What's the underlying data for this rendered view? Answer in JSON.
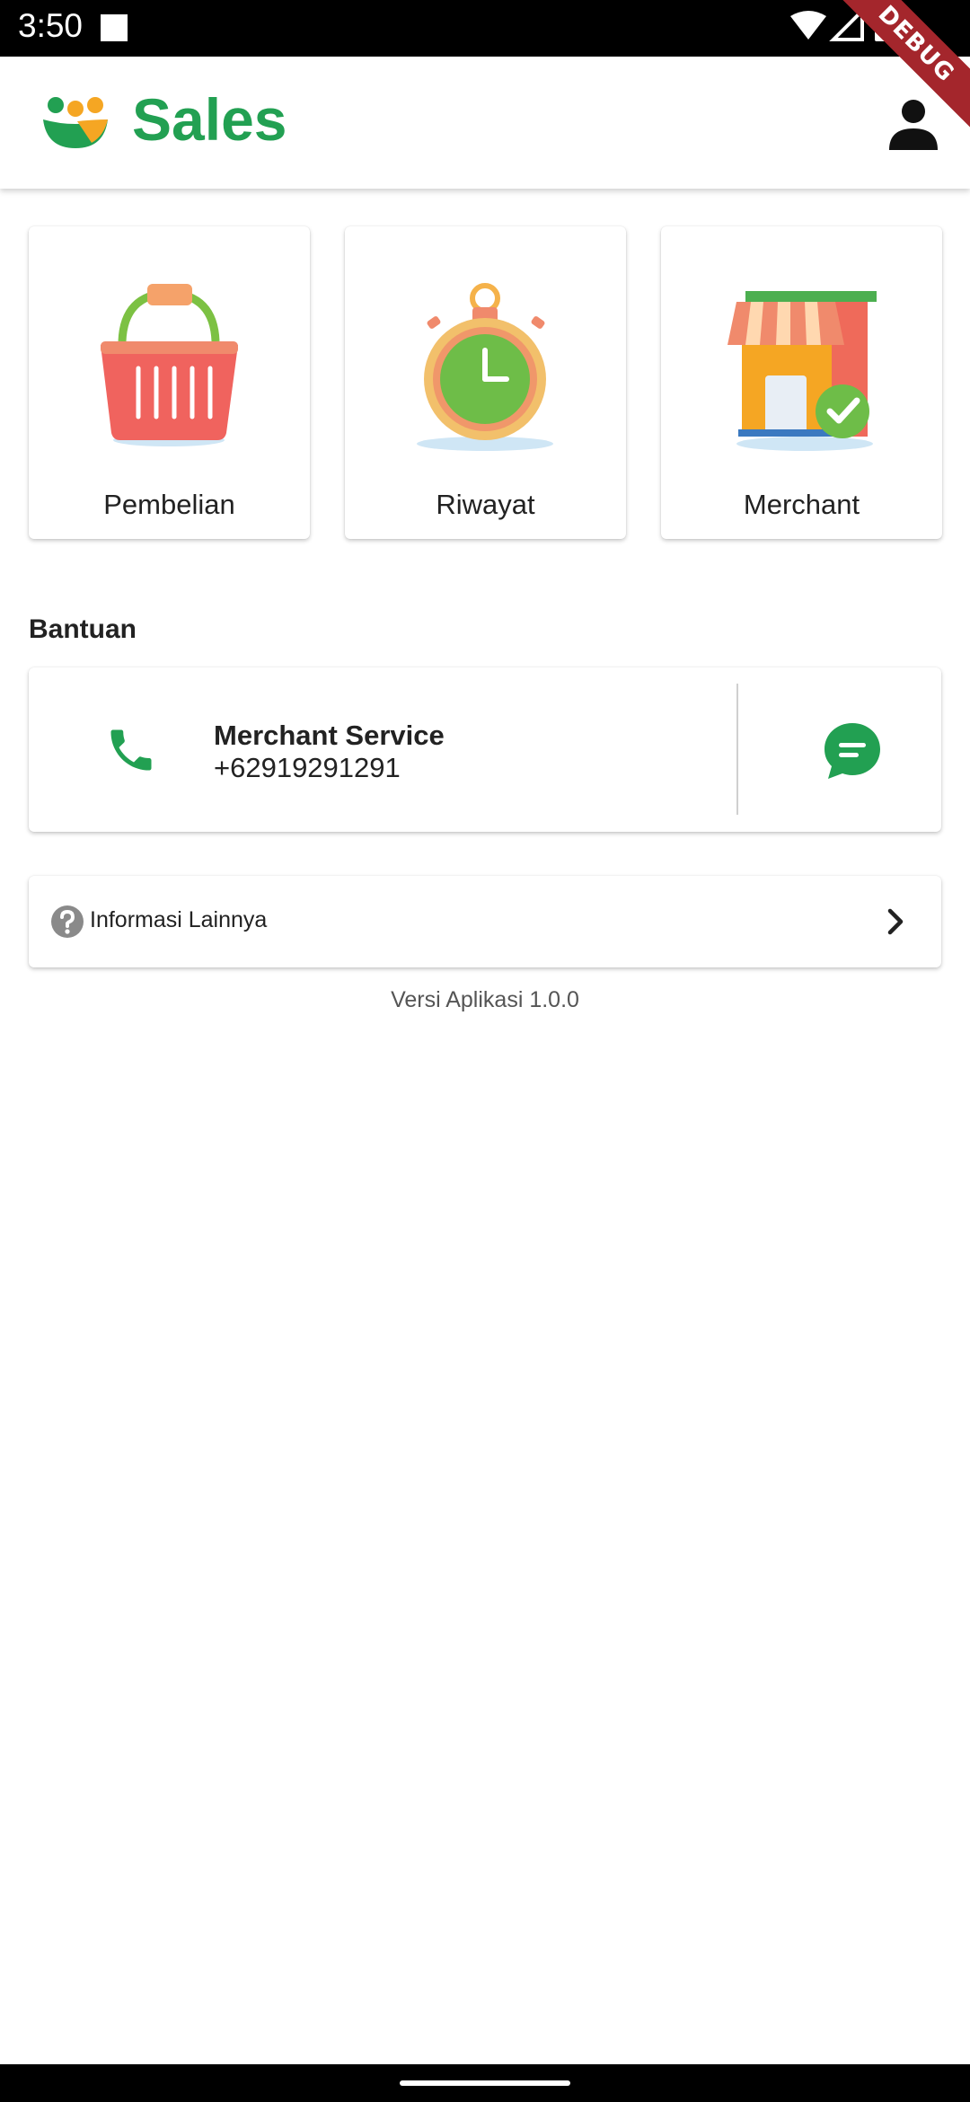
{
  "status_bar": {
    "time": "3:50"
  },
  "debug_banner": {
    "label": "DEBUG"
  },
  "app_bar": {
    "title": "Sales",
    "brand_color": "#22a052",
    "profile_icon": "person-icon",
    "logo_icon": "sales-logo-icon"
  },
  "menu": [
    {
      "label": "Pembelian",
      "icon": "shopping-basket-icon"
    },
    {
      "label": "Riwayat",
      "icon": "stopwatch-icon"
    },
    {
      "label": "Merchant",
      "icon": "store-verified-icon"
    }
  ],
  "help": {
    "section_title": "Bantuan",
    "contact_name": "Merchant Service",
    "contact_number": "+62919291291",
    "phone_icon": "phone-icon",
    "chat_icon": "chat-icon"
  },
  "info": {
    "label": "Informasi Lainnya",
    "icon": "help-circle-icon",
    "chevron": "chevron-right-icon"
  },
  "version": {
    "text": "Versi Aplikasi 1.0.0"
  }
}
